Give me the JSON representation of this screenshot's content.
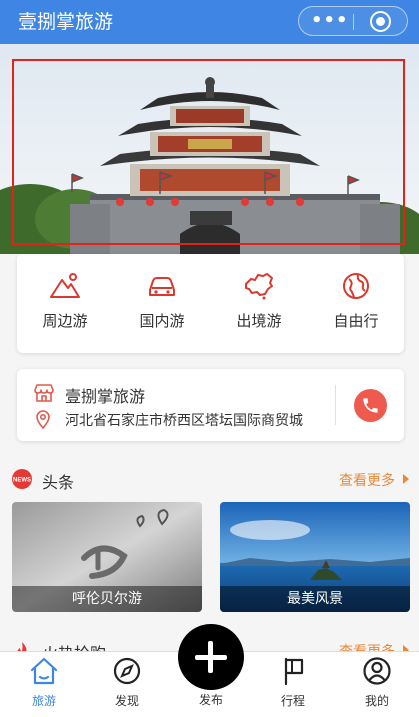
{
  "header": {
    "title": "壹捌掌旅游",
    "more_icon": "ellipsis-icon",
    "close_icon": "target-circle-icon",
    "more_glyph": "•••"
  },
  "banner": {
    "subject": "ancient-tower-photo",
    "plaque_text": "",
    "frame_color": "#e2231a"
  },
  "categories": [
    {
      "label": "周边游",
      "icon": "mountain-icon"
    },
    {
      "label": "国内游",
      "icon": "car-icon"
    },
    {
      "label": "出境游",
      "icon": "china-map-icon"
    },
    {
      "label": "自由行",
      "icon": "globe-icon"
    }
  ],
  "shop": {
    "name": "壹捌掌旅游",
    "address": "河北省石家庄市桥西区塔坛国际商贸城",
    "store_icon": "store-icon",
    "location_icon": "location-pin-icon",
    "phone_icon": "phone-icon"
  },
  "headlines": {
    "badge": "NEWS",
    "title": "头条",
    "see_more": "查看更多"
  },
  "tiles": [
    {
      "caption": "呼伦贝尔游"
    },
    {
      "caption": "最美风景"
    }
  ],
  "hot_deals": {
    "title": "火热抢购",
    "see_more": "查看更多"
  },
  "tabbar": {
    "items": [
      {
        "label": "旅游",
        "icon": "home-icon",
        "active": true
      },
      {
        "label": "发现",
        "icon": "compass-icon",
        "active": false
      },
      {
        "label": "发布",
        "icon": "plus-icon",
        "active": false
      },
      {
        "label": "行程",
        "icon": "flag-icon",
        "active": false
      },
      {
        "label": "我的",
        "icon": "user-icon",
        "active": false
      }
    ]
  },
  "colors": {
    "primary": "#3f86e4",
    "accent": "#e8893a",
    "red": "#e2231a",
    "category_icon": "#d93a2f"
  }
}
